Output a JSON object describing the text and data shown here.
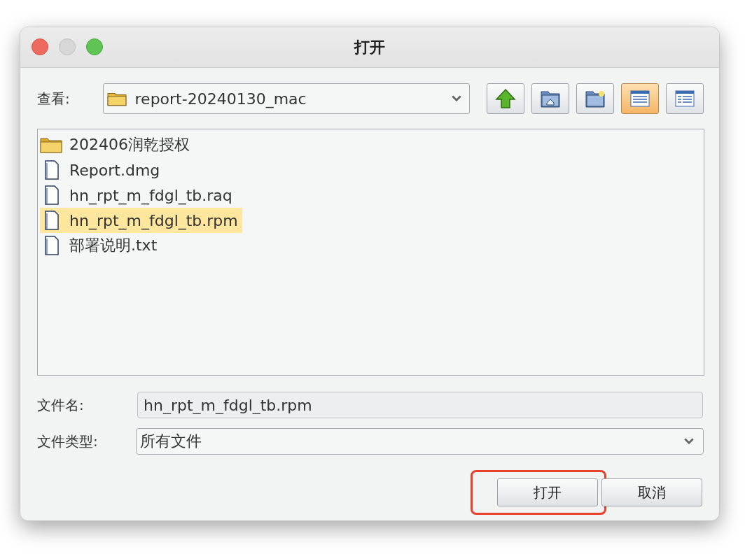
{
  "window": {
    "title": "打开"
  },
  "look_in": {
    "label": "查看:",
    "value": "report-20240130_mac"
  },
  "toolbar": [
    {
      "kind": "up",
      "selected": false
    },
    {
      "kind": "home",
      "selected": false
    },
    {
      "kind": "new_folder",
      "selected": false
    },
    {
      "kind": "list",
      "selected": true
    },
    {
      "kind": "details",
      "selected": false
    }
  ],
  "files": [
    {
      "kind": "folder",
      "name": "202406润乾授权",
      "selected": false
    },
    {
      "kind": "file",
      "name": "Report.dmg",
      "selected": false
    },
    {
      "kind": "file",
      "name": "hn_rpt_m_fdgl_tb.raq",
      "selected": false
    },
    {
      "kind": "file",
      "name": "hn_rpt_m_fdgl_tb.rpm",
      "selected": true
    },
    {
      "kind": "file",
      "name": "部署说明.txt",
      "selected": false
    }
  ],
  "file_name": {
    "label": "文件名:",
    "value": "hn_rpt_m_fdgl_tb.rpm"
  },
  "file_type": {
    "label": "文件类型:",
    "value": "所有文件"
  },
  "buttons": [
    {
      "label": "打开",
      "highlighted": true
    },
    {
      "label": "取消",
      "highlighted": false
    }
  ]
}
